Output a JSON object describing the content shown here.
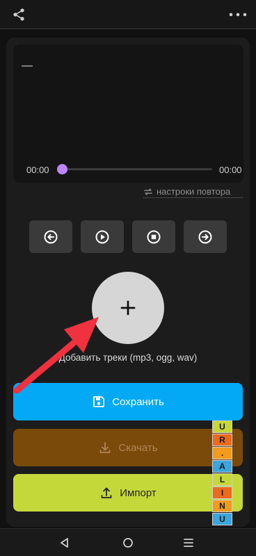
{
  "header": {
    "share_icon": "share-icon",
    "menu_icon": "more-vert-icon"
  },
  "player": {
    "track_title": "—",
    "time_current": "00:00",
    "time_total": "00:00",
    "progress": 0,
    "accent_color": "#bb86fc"
  },
  "repeat": {
    "label": "настроки повтора",
    "icon": "repeat-icon"
  },
  "controls": [
    {
      "name": "previous",
      "icon": "arrow-left-circle-icon"
    },
    {
      "name": "play",
      "icon": "play-circle-icon"
    },
    {
      "name": "stop",
      "icon": "stop-circle-icon"
    },
    {
      "name": "next",
      "icon": "arrow-right-circle-icon"
    }
  ],
  "add_tracks": {
    "icon": "plus-icon",
    "label": "Добавить треки (mp3, ogg, wav)"
  },
  "actions": {
    "save_label": "Сохранить",
    "save_color": "#03a9f4",
    "download_label": "Скачать",
    "download_color": "#7a4a0b",
    "import_label": "Импорт",
    "import_color": "#c5d83a"
  },
  "watermark": {
    "letters": [
      "U",
      "N",
      "I",
      "L",
      "A",
      ".",
      "R",
      "U"
    ]
  },
  "annotation": {
    "arrow_color": "#f0313f"
  },
  "navbar": {
    "back_icon": "back-triangle-icon",
    "home_icon": "home-circle-icon",
    "recents_icon": "recents-lines-icon"
  }
}
